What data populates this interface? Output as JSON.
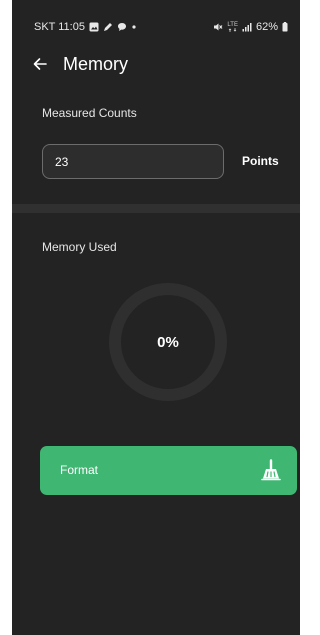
{
  "status_bar": {
    "carrier_time": "SKT 11:05",
    "icons_left": [
      "gallery-icon",
      "pen-icon",
      "chat-icon",
      "dot-icon"
    ],
    "network_label": "LTE",
    "battery": "62%"
  },
  "app_bar": {
    "title": "Memory",
    "back_icon": "arrow-left-icon"
  },
  "measured_counts": {
    "label": "Measured Counts",
    "value": "23",
    "unit": "Points"
  },
  "memory_used": {
    "label": "Memory Used",
    "percent_text": "0%",
    "percent_value": 0
  },
  "format_button": {
    "label": "Format",
    "icon": "broom-icon"
  },
  "colors": {
    "background": "#232323",
    "accent_green": "#3fb772",
    "ring_track": "#2f2f2f"
  }
}
